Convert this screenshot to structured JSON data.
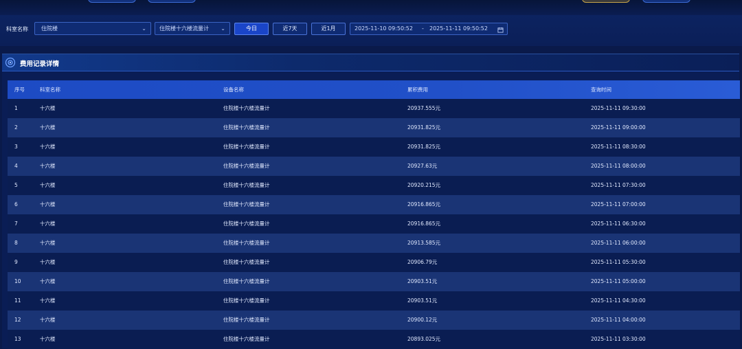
{
  "filter": {
    "dept_label": "科室名称",
    "dept_value": "住院楼",
    "device_value": "住院楼十六楼流量计",
    "btn_today": "今日",
    "btn_7days": "近7天",
    "btn_1month": "近1月",
    "date_start": "2025-11-10 09:50:52",
    "date_sep": "-",
    "date_end": "2025-11-11 09:50:52"
  },
  "panel": {
    "title": "费用记录详情"
  },
  "table": {
    "headers": [
      "序号",
      "科室名称",
      "设备名称",
      "累积费用",
      "查询时间"
    ],
    "rows": [
      [
        "1",
        "十六楼",
        "住院楼十六楼流量计",
        "20937.555元",
        "2025-11-11 09:30:00"
      ],
      [
        "2",
        "十六楼",
        "住院楼十六楼流量计",
        "20931.825元",
        "2025-11-11 09:00:00"
      ],
      [
        "3",
        "十六楼",
        "住院楼十六楼流量计",
        "20931.825元",
        "2025-11-11 08:30:00"
      ],
      [
        "4",
        "十六楼",
        "住院楼十六楼流量计",
        "20927.63元",
        "2025-11-11 08:00:00"
      ],
      [
        "5",
        "十六楼",
        "住院楼十六楼流量计",
        "20920.215元",
        "2025-11-11 07:30:00"
      ],
      [
        "6",
        "十六楼",
        "住院楼十六楼流量计",
        "20916.865元",
        "2025-11-11 07:00:00"
      ],
      [
        "7",
        "十六楼",
        "住院楼十六楼流量计",
        "20916.865元",
        "2025-11-11 06:30:00"
      ],
      [
        "8",
        "十六楼",
        "住院楼十六楼流量计",
        "20913.585元",
        "2025-11-11 06:00:00"
      ],
      [
        "9",
        "十六楼",
        "住院楼十六楼流量计",
        "20906.79元",
        "2025-11-11 05:30:00"
      ],
      [
        "10",
        "十六楼",
        "住院楼十六楼流量计",
        "20903.51元",
        "2025-11-11 05:00:00"
      ],
      [
        "11",
        "十六楼",
        "住院楼十六楼流量计",
        "20903.51元",
        "2025-11-11 04:30:00"
      ],
      [
        "12",
        "十六楼",
        "住院楼十六楼流量计",
        "20900.12元",
        "2025-11-11 04:00:00"
      ],
      [
        "13",
        "十六楼",
        "住院楼十六楼流量计",
        "20893.025元",
        "2025-11-11 03:30:00"
      ]
    ]
  },
  "icons": {
    "dropdown": "chevron-down-icon",
    "calendar": "calendar-icon",
    "panel": "circle-target-icon"
  },
  "colors": {
    "accent": "#1a45c8",
    "background": "#0a1a4a",
    "header_row": "#2150c8",
    "stripe": "#1a3475"
  }
}
